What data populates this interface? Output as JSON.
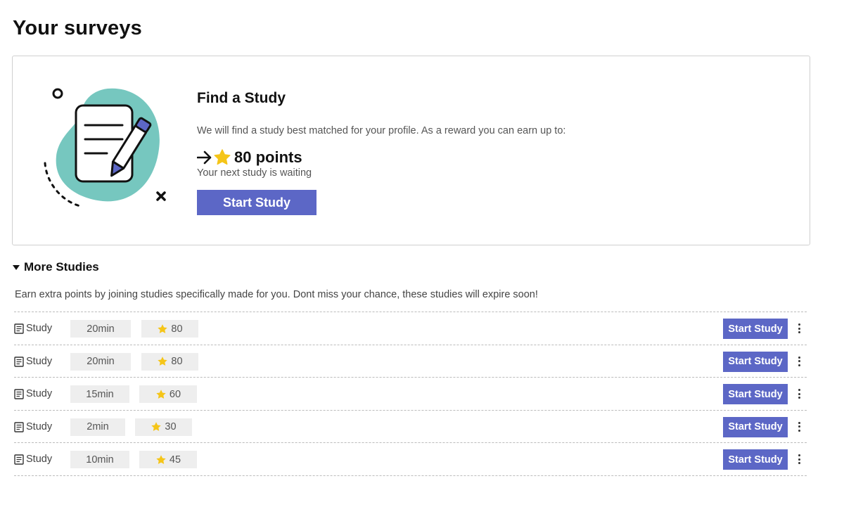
{
  "page": {
    "title": "Your surveys"
  },
  "featured": {
    "title": "Find a Study",
    "description": "We will find a study best matched for your profile. As a reward you can earn up to:",
    "reward": "80 points",
    "waiting": "Your next study is waiting",
    "button_label": "Start Study",
    "icons": {
      "arrow": "arrow-right-icon",
      "star": "star-icon",
      "illustration": "document-pencil-illustration"
    },
    "colors": {
      "accent": "#5c67c6",
      "blob": "#76c7bf",
      "star": "#f5c518"
    }
  },
  "more_studies": {
    "title": "More Studies",
    "description": "Earn extra points by joining studies specifically made for you. Dont miss your chance, these studies will expire soon!",
    "studies": [
      {
        "label": "Study",
        "duration": "20min",
        "points": "80",
        "button_label": "Start Study"
      },
      {
        "label": "Study",
        "duration": "20min",
        "points": "80",
        "button_label": "Start Study"
      },
      {
        "label": "Study",
        "duration": "15min",
        "points": "60",
        "button_label": "Start Study"
      },
      {
        "label": "Study",
        "duration": "2min",
        "points": "30",
        "button_label": "Start Study"
      },
      {
        "label": "Study",
        "duration": "10min",
        "points": "45",
        "button_label": "Start Study"
      }
    ]
  }
}
